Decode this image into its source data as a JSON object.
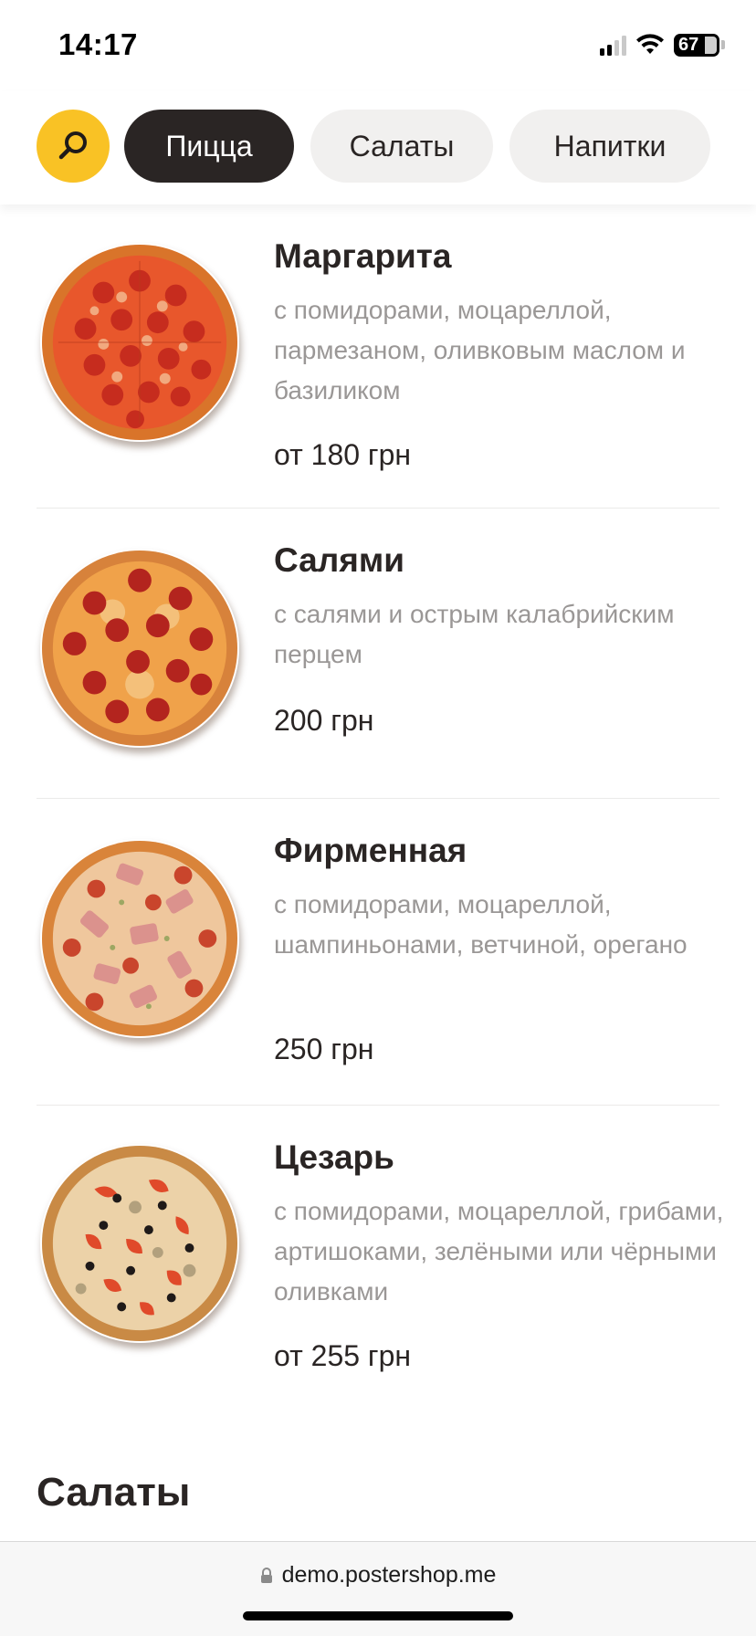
{
  "status_bar": {
    "time": "14:17",
    "battery": "67"
  },
  "categories": {
    "search_icon": "search-icon",
    "chips": [
      {
        "label": "Пицца",
        "active": true
      },
      {
        "label": "Салаты",
        "active": false
      },
      {
        "label": "Напитки",
        "active": false
      }
    ],
    "accent_color": "#f9c225",
    "active_color": "#2a2524"
  },
  "items": [
    {
      "name": "Маргарита",
      "description": "с помидорами, моцареллой, пармезаном, оливковым маслом и базиликом",
      "price": "от 180 грн"
    },
    {
      "name": "Салями",
      "description": "с салями и острым калабрийским перцем",
      "price": "200 грн"
    },
    {
      "name": "Фирменная",
      "description": "с помидорами, моцареллой, шампиньонами, ветчиной, орегано",
      "price": "250 грн"
    },
    {
      "name": "Цезарь",
      "description": "с помидорами, моцареллой, грибами, артишоками, зелёными или чёрными оливками",
      "price": "от 255 грн"
    }
  ],
  "next_section": {
    "title": "Салаты"
  },
  "browser": {
    "url": "demo.postershop.me"
  }
}
